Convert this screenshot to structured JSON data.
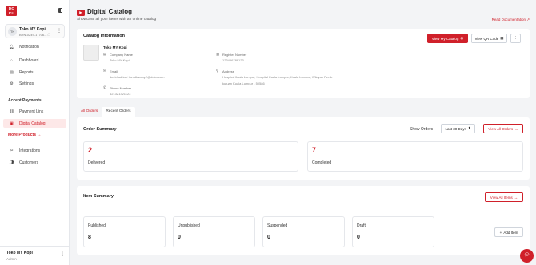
{
  "brand": {
    "logo_text": "DO KU",
    "accent": "#d0202a"
  },
  "store": {
    "initials": "TK",
    "name": "Toko MY Kopi",
    "id": "BRN-0249-17706..."
  },
  "nav": {
    "notification": "Notification",
    "dashboard": "Dashboard",
    "reports": "Reports",
    "settings": "Settings",
    "accept_payments": "Accept Payments",
    "payment_link": "Payment Link",
    "digital_catalog": "Digital Catalog",
    "more_products": "More Products →",
    "integrations": "Integrations",
    "customers": "Customers"
  },
  "footer_user": {
    "name": "Toko MY Kopi",
    "role": "Admin"
  },
  "page": {
    "title": "Digital Catalog",
    "subtitle": "Showcase all your items with an online catalog",
    "doc_link": "Read Documentation"
  },
  "catalog_info": {
    "title": "Catalog Information",
    "view_catalog": "View My Catalog",
    "view_qr": "View QR Code",
    "store_name": "Toko MY Kopi",
    "company_name_label": "Company Name",
    "company_name": "Toko MY Kopi",
    "register_number_label": "Register Number",
    "register_number": "123456789123",
    "email_label": "Email",
    "email": "david.adrian+tamdbsomy2@doku.com",
    "address_label": "Address",
    "address_line1": "Hospital Kuala Lumpur, Hospital Kuala Lumpur, Kuala Lumpur, Wilayah Persk",
    "address_line2": "kutuan Kuala Lumpur - 50586",
    "phone_label": "Phone Number",
    "phone": "621321321123"
  },
  "tabs": [
    {
      "label": "All Orders"
    },
    {
      "label": "Recent Orders"
    }
  ],
  "order_summary": {
    "title": "Order Summary",
    "show_orders": "Show Orders",
    "period": "Last 30 Days",
    "view_all": "View All Orders",
    "delivered_count": "2",
    "delivered_label": "Delivered",
    "completed_count": "7",
    "completed_label": "Completed"
  },
  "item_summary": {
    "title": "Item Summary",
    "view_all": "View All Items",
    "add_item": "Add Item",
    "stats": [
      {
        "label": "Published",
        "value": "8"
      },
      {
        "label": "Unpublished",
        "value": "0"
      },
      {
        "label": "Suspended",
        "value": "0"
      },
      {
        "label": "Draft",
        "value": "0"
      }
    ]
  },
  "colors": {
    "primary": "#d0202a",
    "page_bg": "#f3f4f6",
    "active_nav_bg": "#fde8e8"
  }
}
